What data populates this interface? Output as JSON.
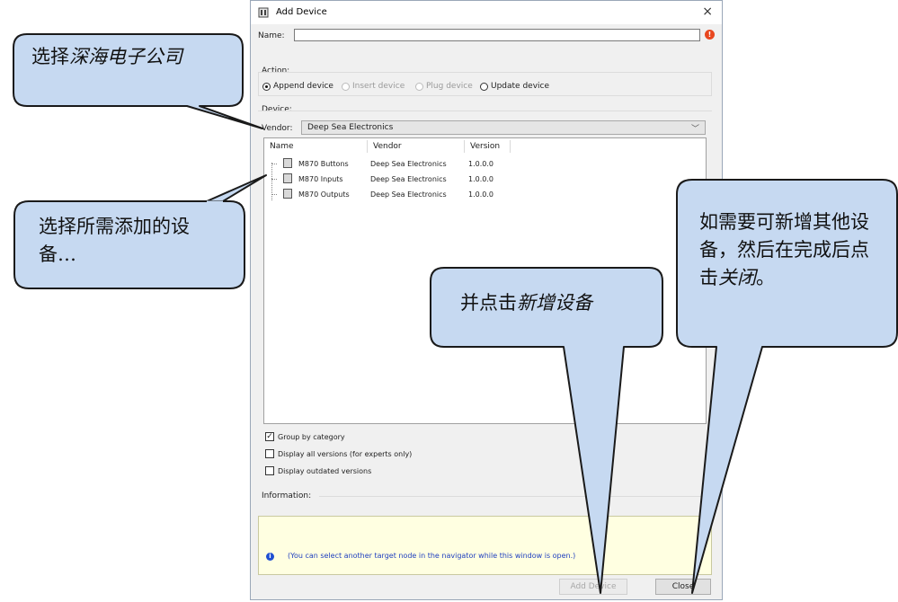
{
  "dialog": {
    "title": "Add Device",
    "close_glyph": "×",
    "name_label": "Name:",
    "name_value": "",
    "error_icon": "!",
    "action_label": "Action:",
    "actions": [
      {
        "label": "Append device",
        "selected": true,
        "enabled": true
      },
      {
        "label": "Insert device",
        "selected": false,
        "enabled": false
      },
      {
        "label": "Plug device",
        "selected": false,
        "enabled": false
      },
      {
        "label": "Update device",
        "selected": false,
        "enabled": true
      }
    ],
    "device_label": "Device:",
    "vendor_label": "Vendor:",
    "vendor_value": "Deep Sea Electronics",
    "columns": [
      "Name",
      "Vendor",
      "Version"
    ],
    "rows": [
      {
        "name": "M870 Buttons",
        "vendor": "Deep Sea Electronics",
        "version": "1.0.0.0"
      },
      {
        "name": "M870 Inputs",
        "vendor": "Deep Sea Electronics",
        "version": "1.0.0.0"
      },
      {
        "name": "M870 Outputs",
        "vendor": "Deep Sea Electronics",
        "version": "1.0.0.0"
      }
    ],
    "options": [
      {
        "label": "Group by category",
        "checked": true
      },
      {
        "label": "Display all versions (for experts only)",
        "checked": false
      },
      {
        "label": "Display outdated versions",
        "checked": false
      }
    ],
    "information_label": "Information:",
    "info_icon": "i",
    "info_text": "(You can select another target node in the navigator while this window is open.)",
    "add_button": "Add Device",
    "close_button": "Close"
  },
  "callouts": {
    "vendor_prefix": "选择",
    "vendor_italic": "深海电子公司",
    "devices": "选择所需添加的设备…",
    "add_prefix": "并点击",
    "add_italic": "新增设备",
    "close_part1": "如需要可新增其他设备，然后在完成后点击",
    "close_italic": "关闭",
    "close_end": "。"
  },
  "colors": {
    "callout_fill": "#c6d9f1",
    "callout_stroke": "#1a1a1a",
    "info_bg": "#ffffe1",
    "info_text": "#1f3fbf"
  }
}
